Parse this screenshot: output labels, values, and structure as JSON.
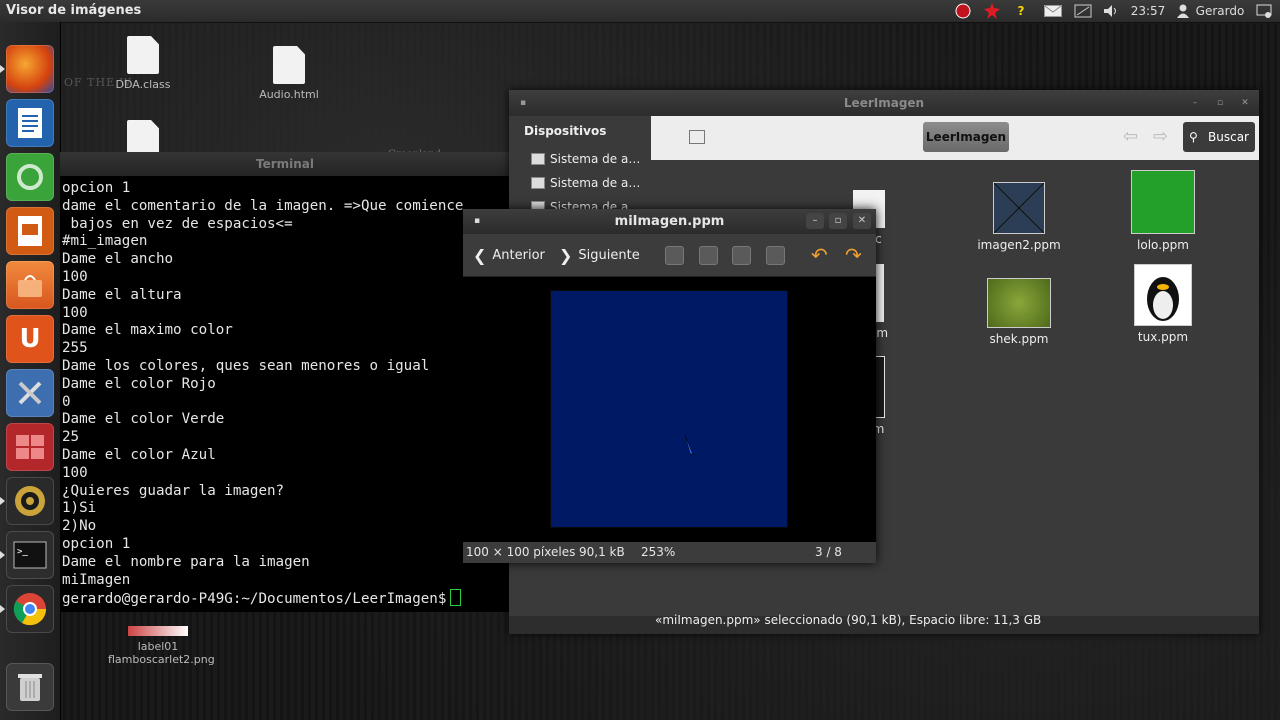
{
  "top_panel": {
    "app_title": "Visor de imágenes",
    "time": "23:57",
    "user": "Gerardo"
  },
  "desktop": {
    "icons": [
      {
        "label": "DDA.class"
      },
      {
        "label": "Audio.html"
      },
      {
        "label": ""
      },
      {
        "label": "label01 flamboscarlet2.png"
      }
    ],
    "wallpaper_text": "Greenland",
    "wallpaper_text2": "OF THE W"
  },
  "terminal": {
    "title": "Terminal",
    "lines": [
      "opcion 1",
      "dame el comentario de la imagen. =>Que comience",
      " bajos en vez de espacios<=",
      "#mi_imagen",
      "Dame el ancho",
      "100",
      "Dame el altura",
      "100",
      "Dame el maximo color",
      "255",
      "Dame los colores, ques sean menores o igual",
      "Dame el color Rojo",
      "0",
      "Dame el color Verde",
      "25",
      "Dame el color Azul",
      "100",
      "¿Quieres guadar la imagen?",
      "1)Si",
      "2)No",
      "opcion 1",
      "Dame el nombre para la imagen",
      "miImagen"
    ],
    "prompt": "gerardo@gerardo-P49G:~/Documentos/LeerImagen$"
  },
  "file_manager": {
    "title": "LeerImagen",
    "sidebar_header": "Dispositivos",
    "sidebar_items": [
      "Sistema de a…",
      "Sistema de a…",
      "Sistema de a…"
    ],
    "path_button": "LeerImagen",
    "search_label": "Buscar",
    "files": [
      {
        "name": "en.c"
      },
      {
        "name": "imagen2.ppm"
      },
      {
        "name": "lolo.ppm"
      },
      {
        "name": "a.ppm"
      },
      {
        "name": "shek.ppm"
      },
      {
        "name": "tux.ppm"
      },
      {
        "name": ".ppm"
      }
    ],
    "status": "«miImagen.ppm» seleccionado (90,1 kB), Espacio libre: 11,3 GB"
  },
  "viewer": {
    "title": "miImagen.ppm",
    "prev_label": "Anterior",
    "next_label": "Siguiente",
    "image_color": "#001964",
    "status_size": "100 × 100 píxeles",
    "status_filesize": "90,1 kB",
    "status_zoom": "253%",
    "status_index": "3 / 8"
  }
}
